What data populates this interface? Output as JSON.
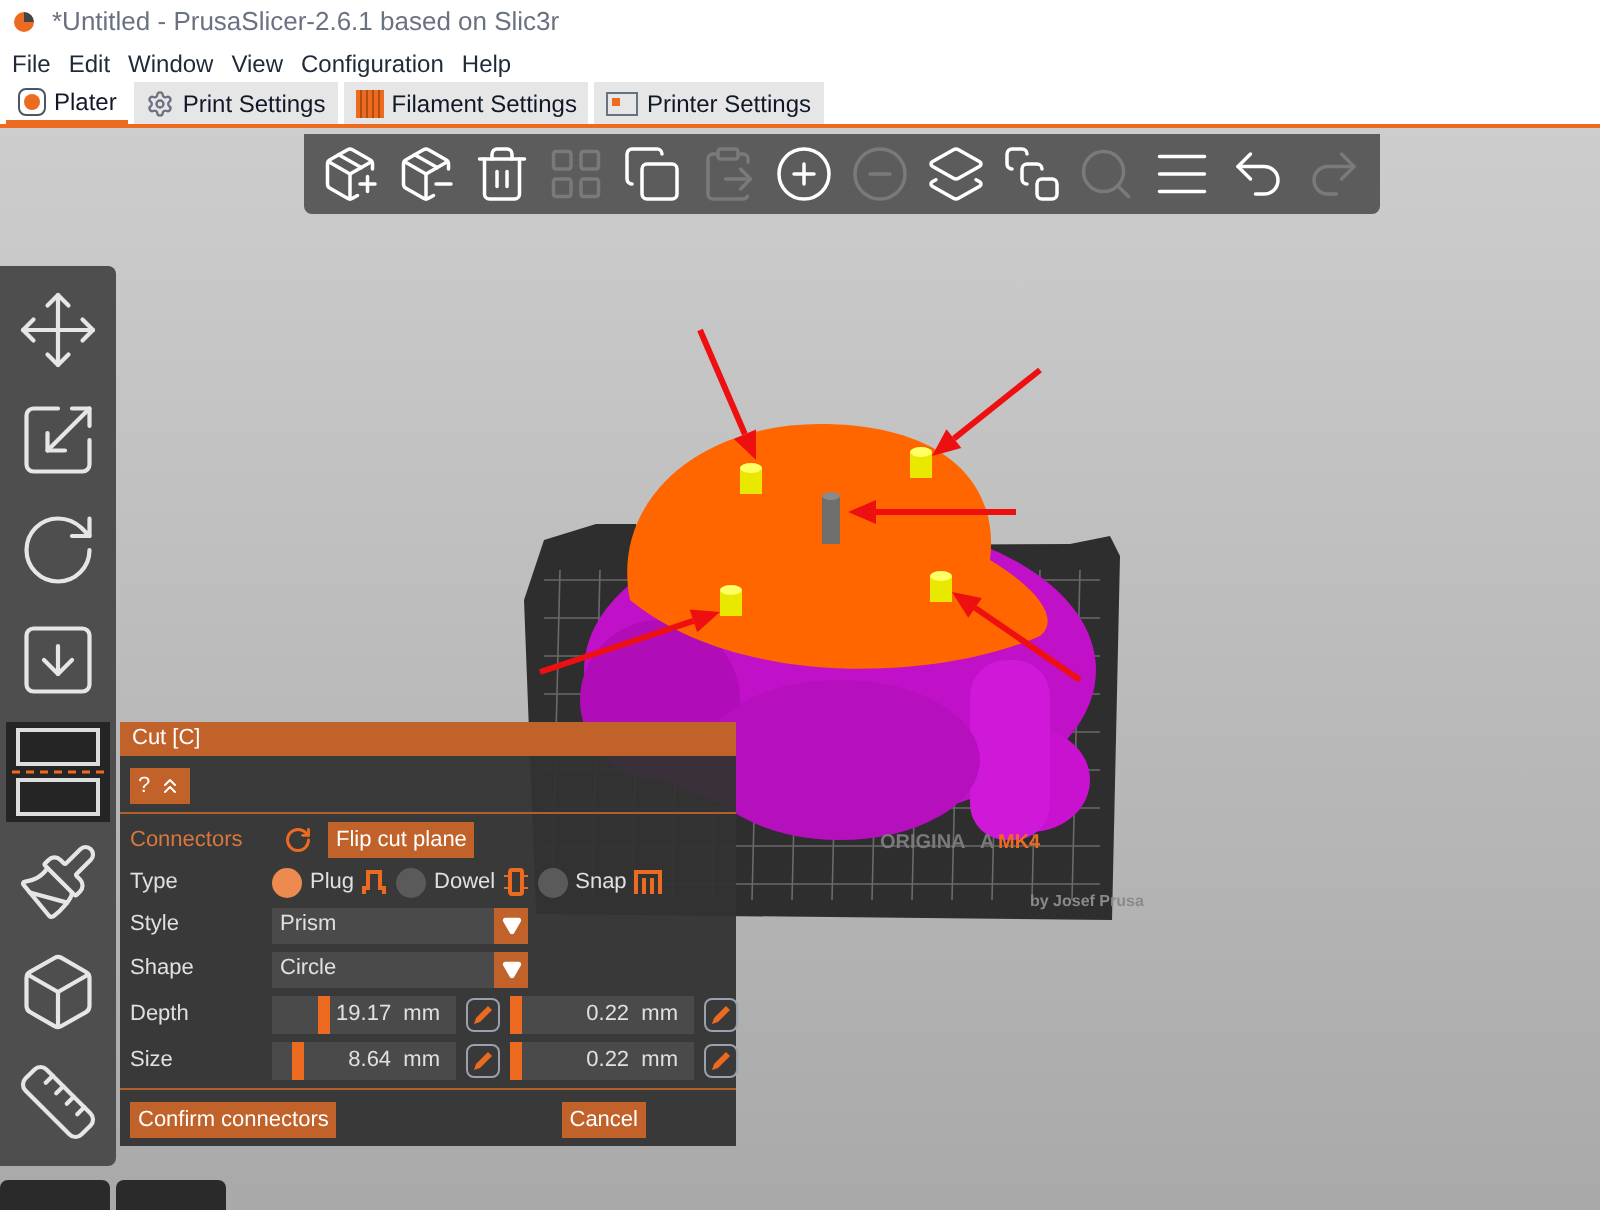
{
  "window": {
    "title": "*Untitled - PrusaSlicer-2.6.1 based on Slic3r"
  },
  "menu": [
    "File",
    "Edit",
    "Window",
    "View",
    "Configuration",
    "Help"
  ],
  "tabs": [
    {
      "label": "Plater",
      "kind": "plater",
      "selected": true
    },
    {
      "label": "Print Settings",
      "kind": "print",
      "selected": false
    },
    {
      "label": "Filament Settings",
      "kind": "filament",
      "selected": false
    },
    {
      "label": "Printer Settings",
      "kind": "printer",
      "selected": false
    }
  ],
  "toolbar": [
    {
      "kind": "add",
      "disabled": false
    },
    {
      "kind": "delete",
      "disabled": false
    },
    {
      "kind": "delete_all",
      "disabled": false
    },
    {
      "kind": "arrange",
      "disabled": true
    },
    {
      "kind": "copy",
      "disabled": false
    },
    {
      "kind": "paste",
      "disabled": true
    },
    {
      "kind": "add_instance",
      "disabled": false
    },
    {
      "kind": "remove_instance",
      "disabled": true
    },
    {
      "kind": "split_objects",
      "disabled": false
    },
    {
      "kind": "split_parts",
      "disabled": false
    },
    {
      "kind": "search",
      "disabled": true
    },
    {
      "kind": "layers",
      "disabled": false
    },
    {
      "kind": "undo",
      "disabled": false
    },
    {
      "kind": "redo",
      "disabled": true
    }
  ],
  "gizmos": [
    {
      "kind": "move",
      "selected": false
    },
    {
      "kind": "scale",
      "selected": false
    },
    {
      "kind": "rotate",
      "selected": false
    },
    {
      "kind": "place",
      "selected": false
    },
    {
      "kind": "cut",
      "selected": true
    },
    {
      "kind": "paint",
      "selected": false
    },
    {
      "kind": "support",
      "selected": false
    },
    {
      "kind": "measure",
      "selected": false
    }
  ],
  "bed_labels": [
    {
      "text": "ORIGINA",
      "kind": "plain"
    },
    {
      "text": "A",
      "kind": "plain"
    },
    {
      "text": "MK4",
      "kind": "accent"
    },
    {
      "text": "by Josef Prusa",
      "kind": "small"
    }
  ],
  "cut_panel": {
    "title": "Cut [C]",
    "help_button": "?",
    "connectors_label": "Connectors",
    "flip_button": "Flip cut plane",
    "type": {
      "label": "Type",
      "options": [
        {
          "label": "Plug",
          "kind": "plug",
          "selected": true
        },
        {
          "label": "Dowel",
          "kind": "dowel",
          "selected": false
        },
        {
          "label": "Snap",
          "kind": "snap",
          "selected": false
        }
      ]
    },
    "style": {
      "label": "Style",
      "value": "Prism"
    },
    "shape": {
      "label": "Shape",
      "value": "Circle"
    },
    "depth": {
      "label": "Depth",
      "fields": [
        {
          "value": "19.17  mm",
          "level": 0.27
        },
        {
          "value": "0.22  mm",
          "level": 0.0
        }
      ]
    },
    "size": {
      "label": "Size",
      "fields": [
        {
          "value": "8.64  mm",
          "level": 0.12
        },
        {
          "value": "0.22  mm",
          "level": 0.0
        }
      ]
    },
    "confirm_button": "Confirm connectors",
    "cancel_button": "Cancel"
  }
}
